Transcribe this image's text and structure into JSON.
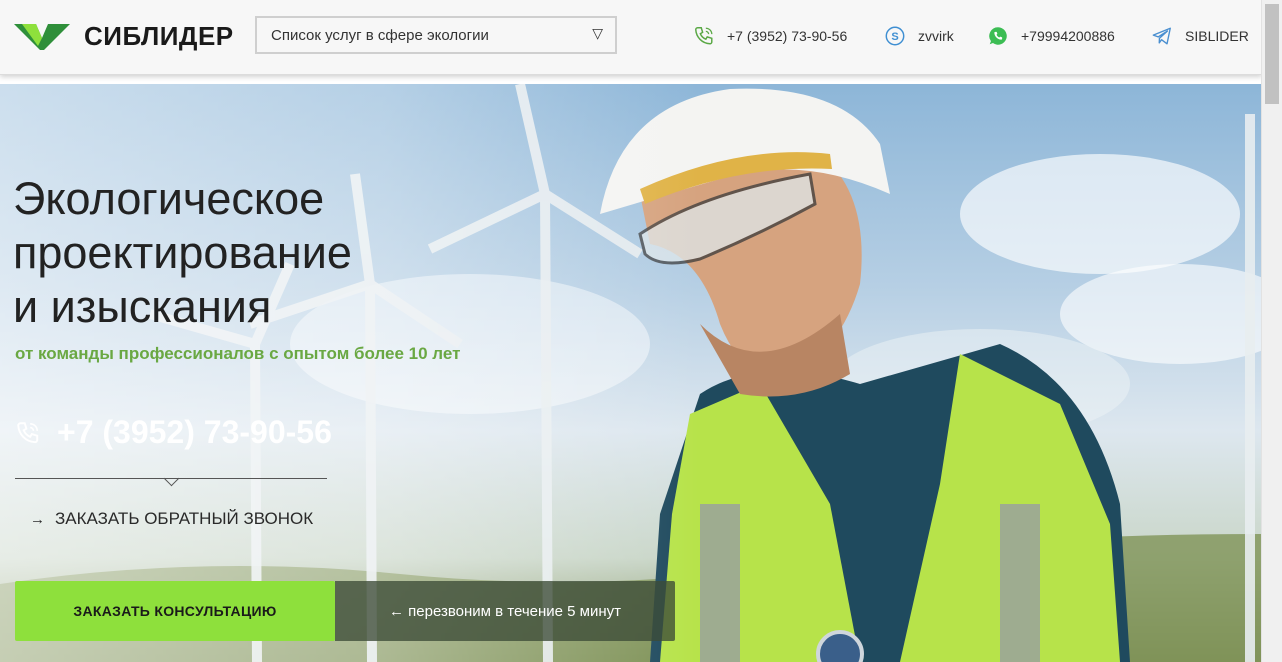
{
  "header": {
    "brand": "СИБЛИДЕР",
    "service_select": {
      "value": "Список услуг в сфере экологии",
      "arrow": "▽"
    },
    "contacts": [
      {
        "icon": "phone-icon",
        "text": "+7 (3952) 73-90-56"
      },
      {
        "icon": "skype-icon",
        "text": "zvvirk"
      },
      {
        "icon": "whatsapp-icon",
        "text": "+79994200886"
      },
      {
        "icon": "telegram-icon",
        "text": "SIBLIDER"
      }
    ]
  },
  "hero": {
    "title_lines": [
      "Экологическое",
      "проектирование",
      "и изыскания"
    ],
    "subtitle": "от команды профессионалов с опытом более 10 лет",
    "phone": "+7 (3952) 73-90-56",
    "callback_arrow": "→",
    "callback_label": "ЗАКАЗАТЬ ОБРАТНЫЙ ЗВОНОК",
    "consult_button": "ЗАКАЗАТЬ КОНСУЛЬТАЦИЮ",
    "recall_note": "← перезвоним в течение 5 минут"
  },
  "colors": {
    "accent_green": "#8ee03c",
    "subtitle_green": "#6aa843",
    "brand_dark_green": "#2f8f3a"
  }
}
